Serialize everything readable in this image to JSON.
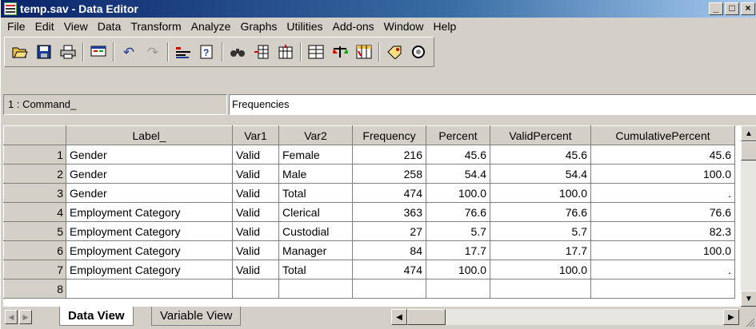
{
  "window": {
    "title": "temp.sav - Data Editor",
    "buttons": {
      "minimize": "_",
      "maximize": "□",
      "close": "×"
    }
  },
  "menu": [
    "File",
    "Edit",
    "View",
    "Data",
    "Transform",
    "Analyze",
    "Graphs",
    "Utilities",
    "Add-ons",
    "Window",
    "Help"
  ],
  "toolbar": {
    "icons": [
      "open-icon",
      "save-icon",
      "print-icon",
      "dialog-recall-icon",
      "undo-icon",
      "redo-icon",
      "goto-case-icon",
      "variables-icon",
      "find-icon",
      "insert-cases-icon",
      "insert-variable-icon",
      "split-file-icon",
      "weight-cases-icon",
      "select-cases-icon",
      "value-labels-icon",
      "use-sets-icon"
    ]
  },
  "cell_editor": {
    "reference": "1 : Command_",
    "value": "Frequencies"
  },
  "grid": {
    "columns": [
      "Label_",
      "Var1",
      "Var2",
      "Frequency",
      "Percent",
      "ValidPercent",
      "CumulativePercent"
    ],
    "rows": [
      {
        "n": "1",
        "cells": [
          "Gender",
          "Valid",
          "Female",
          "216",
          "45.6",
          "45.6",
          "45.6"
        ]
      },
      {
        "n": "2",
        "cells": [
          "Gender",
          "Valid",
          "Male",
          "258",
          "54.4",
          "54.4",
          "100.0"
        ]
      },
      {
        "n": "3",
        "cells": [
          "Gender",
          "Valid",
          "Total",
          "474",
          "100.0",
          "100.0",
          "."
        ]
      },
      {
        "n": "4",
        "cells": [
          "Employment Category",
          "Valid",
          "Clerical",
          "363",
          "76.6",
          "76.6",
          "76.6"
        ]
      },
      {
        "n": "5",
        "cells": [
          "Employment Category",
          "Valid",
          "Custodial",
          "27",
          "5.7",
          "5.7",
          "82.3"
        ]
      },
      {
        "n": "6",
        "cells": [
          "Employment Category",
          "Valid",
          "Manager",
          "84",
          "17.7",
          "17.7",
          "100.0"
        ]
      },
      {
        "n": "7",
        "cells": [
          "Employment Category",
          "Valid",
          "Total",
          "474",
          "100.0",
          "100.0",
          "."
        ]
      },
      {
        "n": "8",
        "cells": [
          "",
          "",
          "",
          "",
          "",
          "",
          ""
        ]
      }
    ]
  },
  "tabs": {
    "data_view": "Data View",
    "variable_view": "Variable View"
  }
}
